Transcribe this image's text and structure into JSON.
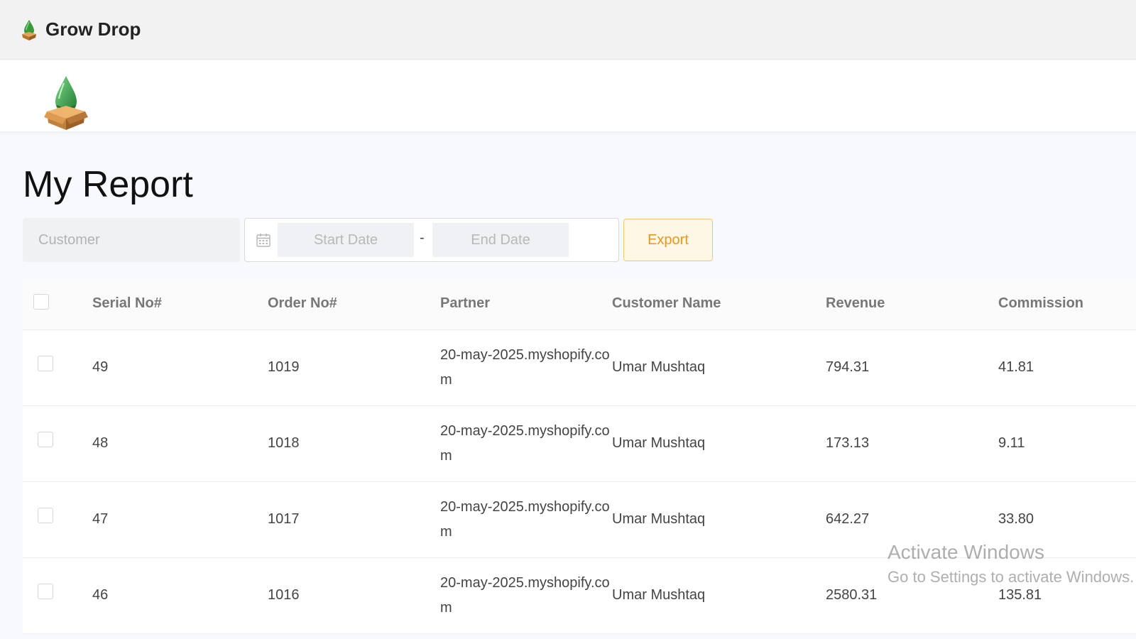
{
  "app": {
    "title": "Grow Drop",
    "icon": "grow-drop-logo-icon"
  },
  "logo": {
    "icon": "grow-drop-logo"
  },
  "page": {
    "title": "My Report"
  },
  "filters": {
    "customer_placeholder": "Customer",
    "start_date_placeholder": "Start Date",
    "end_date_placeholder": "End Date",
    "date_separator": "-",
    "calendar_icon": "calendar-icon",
    "export_label": "Export"
  },
  "table": {
    "headers": [
      "Serial No#",
      "Order No#",
      "Partner",
      "Customer Name",
      "Revenue",
      "Commission"
    ],
    "rows": [
      {
        "serial": "49",
        "order": "1019",
        "partner": "20-may-2025.myshopify.com",
        "customer": "Umar Mushtaq",
        "revenue": "794.31",
        "commission": "41.81"
      },
      {
        "serial": "48",
        "order": "1018",
        "partner": "20-may-2025.myshopify.com",
        "customer": "Umar Mushtaq",
        "revenue": "173.13",
        "commission": "9.11"
      },
      {
        "serial": "47",
        "order": "1017",
        "partner": "20-may-2025.myshopify.com",
        "customer": "Umar Mushtaq",
        "revenue": "642.27",
        "commission": "33.80"
      },
      {
        "serial": "46",
        "order": "1016",
        "partner": "20-may-2025.myshopify.com",
        "customer": "Umar Mushtaq",
        "revenue": "2580.31",
        "commission": "135.81"
      }
    ]
  },
  "watermark": {
    "title": "Activate Windows",
    "subtitle": "Go to Settings to activate Windows."
  },
  "colors": {
    "accent": "#e8961f",
    "export_bg": "#fff7e6",
    "logo_green": "#2e9e3e",
    "box_brown": "#c0813e"
  }
}
